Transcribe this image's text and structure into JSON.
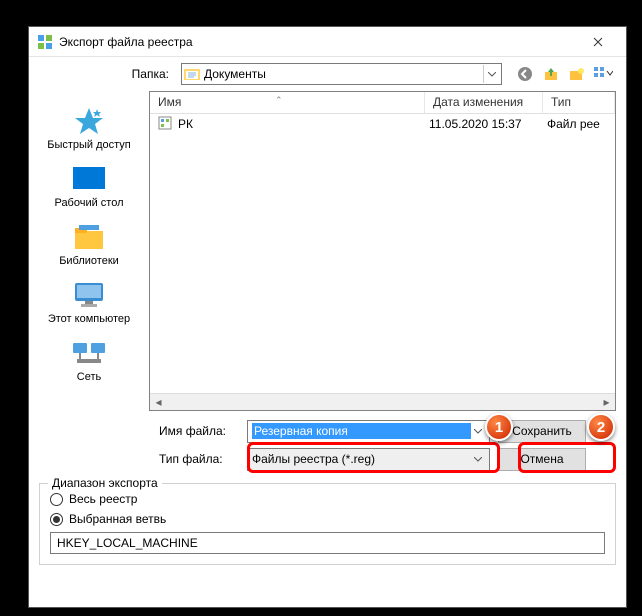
{
  "title": "Экспорт файла реестра",
  "folder": {
    "label": "Папка:",
    "value": "Документы"
  },
  "places": [
    {
      "label": "Быстрый доступ",
      "icon": "star"
    },
    {
      "label": "Рабочий стол",
      "icon": "desktop"
    },
    {
      "label": "Библиотеки",
      "icon": "libraries"
    },
    {
      "label": "Этот компьютер",
      "icon": "computer"
    },
    {
      "label": "Сеть",
      "icon": "network"
    }
  ],
  "columns": {
    "name": "Имя",
    "date": "Дата изменения",
    "type": "Тип"
  },
  "files": [
    {
      "name": "РК",
      "date": "11.05.2020 15:37",
      "type": "Файл рее"
    }
  ],
  "fields": {
    "filename_label": "Имя файла:",
    "filename_value": "Резервная копия",
    "filetype_label": "Тип файла:",
    "filetype_value": "Файлы реестра (*.reg)"
  },
  "buttons": {
    "save": "Сохранить",
    "cancel": "Отмена"
  },
  "export": {
    "legend": "Диапазон экспорта",
    "all": "Весь реестр",
    "selected": "Выбранная ветвь",
    "branch": "HKEY_LOCAL_MACHINE"
  },
  "callouts": {
    "one": "1",
    "two": "2"
  }
}
